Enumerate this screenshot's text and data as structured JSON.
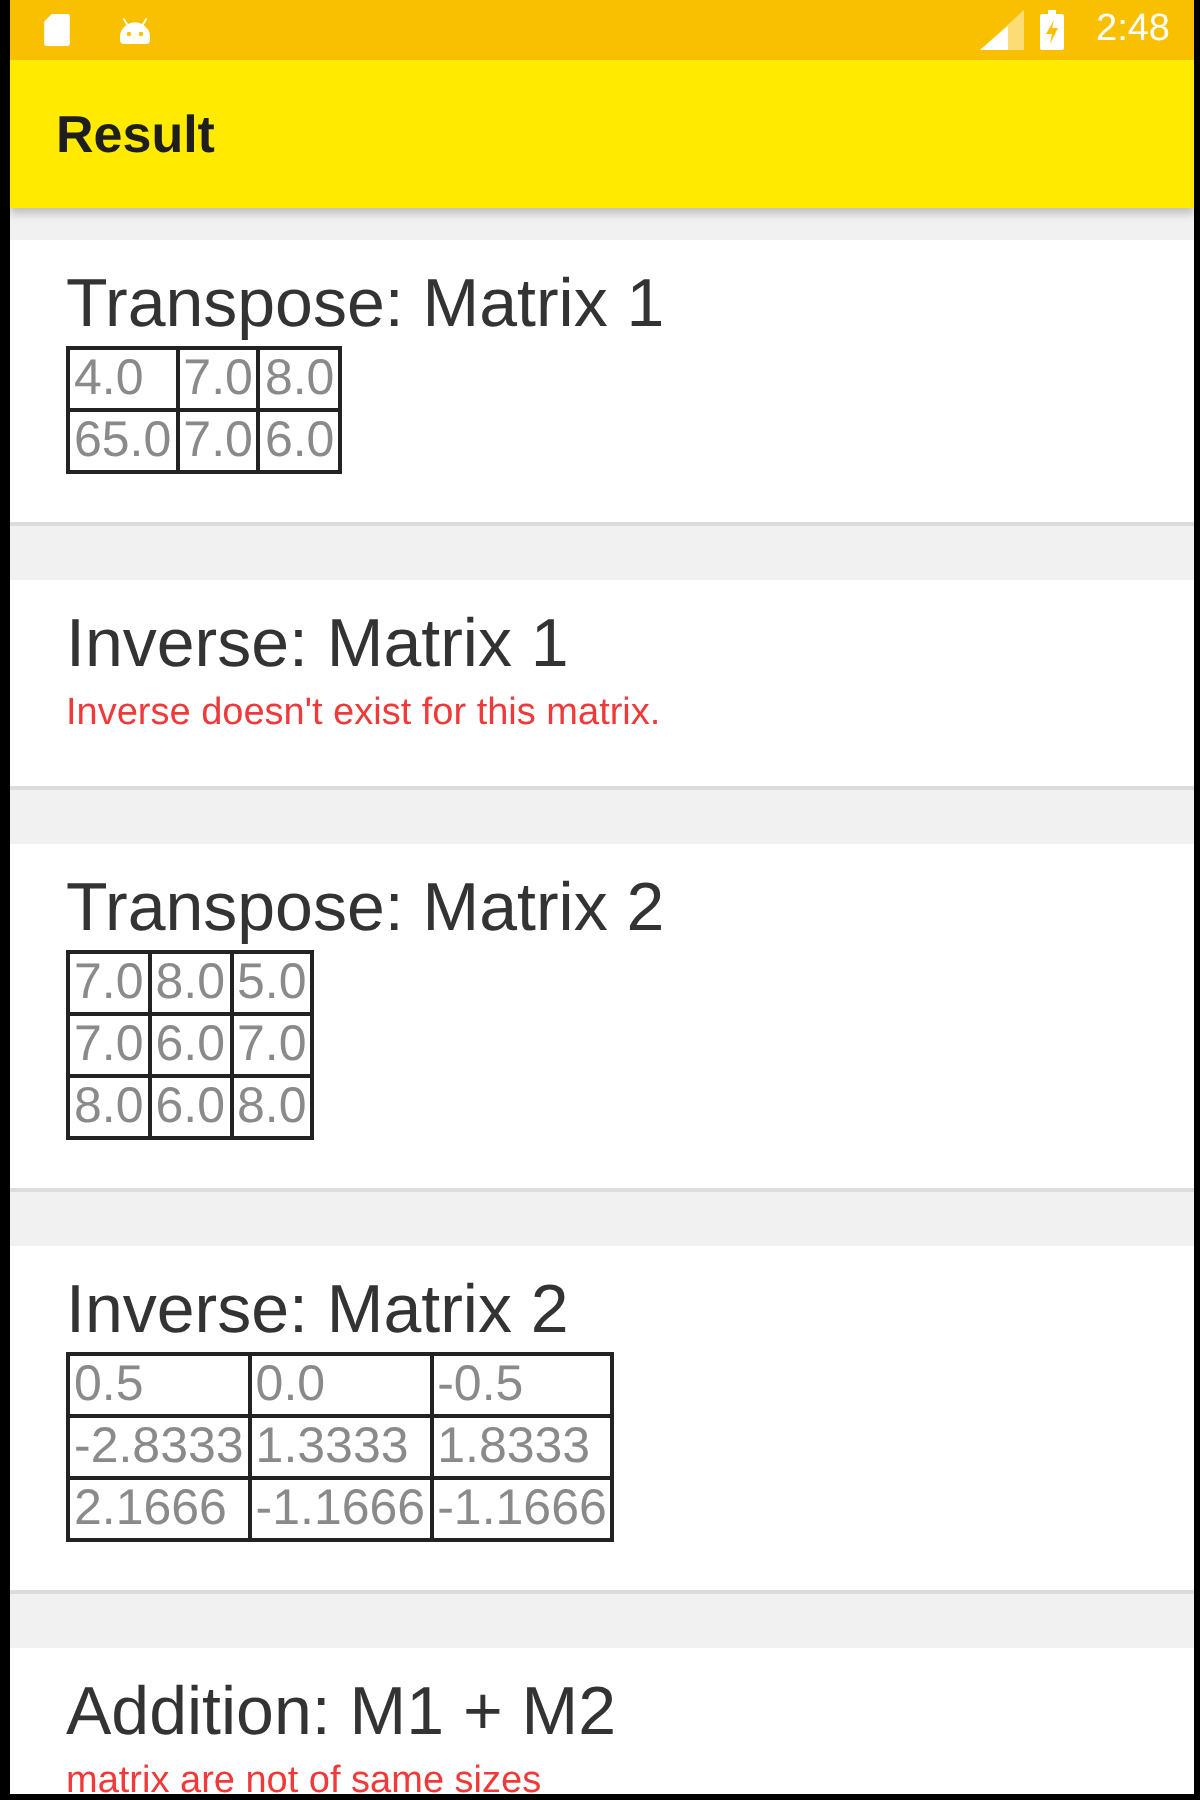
{
  "status_bar": {
    "time": "2:48"
  },
  "app_bar": {
    "title": "Result"
  },
  "sections": [
    {
      "kind": "matrix",
      "title": "Transpose: Matrix 1",
      "rows": [
        [
          "4.0",
          "7.0",
          "8.0"
        ],
        [
          "65.0",
          "7.0",
          "6.0"
        ]
      ]
    },
    {
      "kind": "message",
      "title": "Inverse: Matrix 1",
      "message": "Inverse doesn't exist for this matrix."
    },
    {
      "kind": "matrix",
      "title": "Transpose: Matrix 2",
      "rows": [
        [
          "7.0",
          "8.0",
          "5.0"
        ],
        [
          "7.0",
          "6.0",
          "7.0"
        ],
        [
          "8.0",
          "6.0",
          "8.0"
        ]
      ]
    },
    {
      "kind": "matrix",
      "title": "Inverse: Matrix 2",
      "rows": [
        [
          "0.5",
          "0.0",
          "-0.5"
        ],
        [
          "-2.8333",
          "1.3333",
          "1.8333"
        ],
        [
          "2.1666",
          "-1.1666",
          "-1.1666"
        ]
      ]
    },
    {
      "kind": "message",
      "title": "Addition: M1 + M2",
      "message": "matrix are not of same sizes"
    }
  ]
}
